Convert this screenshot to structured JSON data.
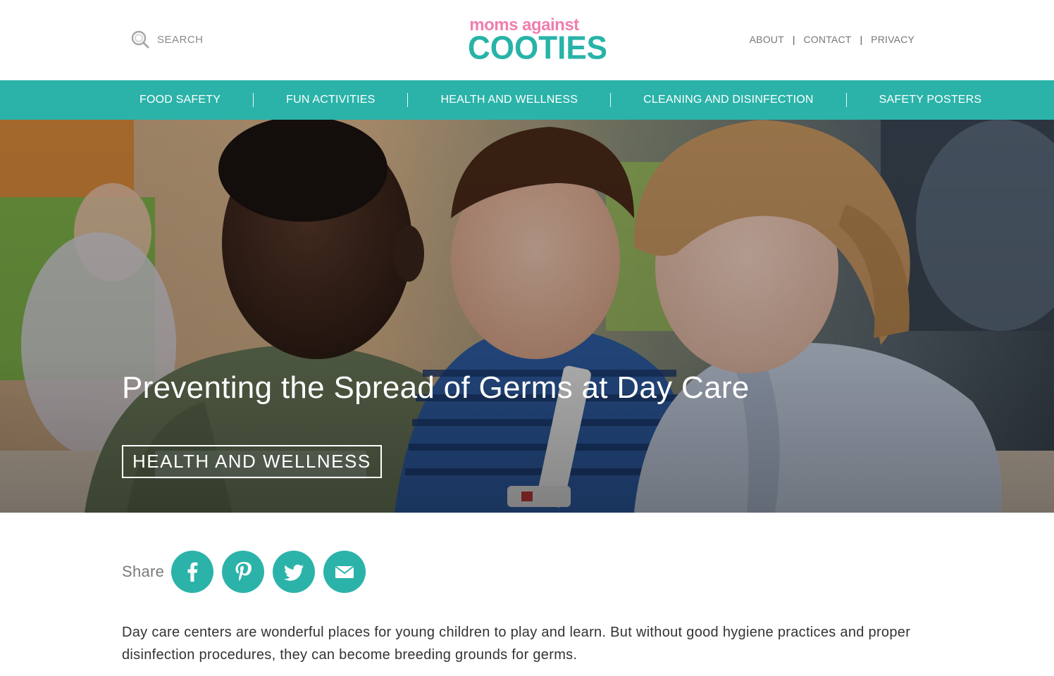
{
  "header": {
    "search_placeholder": "SEARCH",
    "logo_top": "moms against",
    "logo_bottom": "COOTIES",
    "util_links": [
      "ABOUT",
      "CONTACT",
      "PRIVACY"
    ]
  },
  "nav": {
    "items": [
      "FOOD SAFETY",
      "FUN ACTIVITIES",
      "HEALTH AND WELLNESS",
      "CLEANING AND DISINFECTION",
      "SAFETY POSTERS"
    ]
  },
  "hero": {
    "title": "Preventing the Spread of Germs at Day Care",
    "category": "HEALTH AND WELLNESS",
    "image": "three-children-playing-photo"
  },
  "share": {
    "label": "Share",
    "buttons": [
      "facebook-icon",
      "pinterest-icon",
      "twitter-icon",
      "email-icon"
    ]
  },
  "article": {
    "intro": "Day care centers are wonderful places for young children to play and learn. But without good hygiene practices and proper disinfection procedures, they can become breeding grounds for germs."
  },
  "colors": {
    "teal": "#2bb3a9",
    "pink": "#ef7fae",
    "text": "#333333"
  }
}
